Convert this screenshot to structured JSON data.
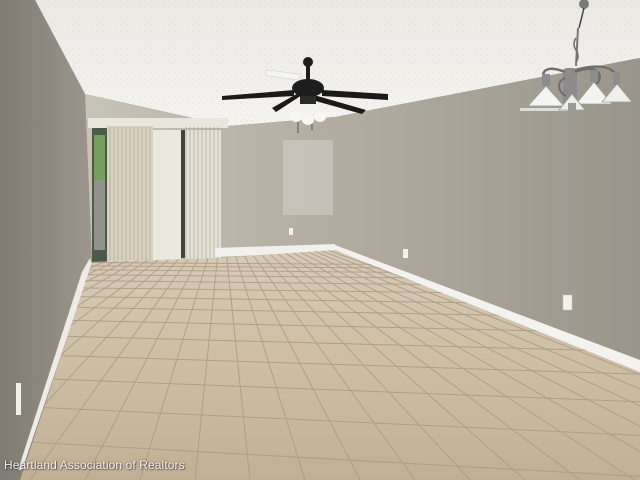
{
  "photo": {
    "subject": "empty living room with tile floor",
    "colors": {
      "ceiling": "#f0eee9",
      "wall_right": "#a7a295",
      "wall_back": "#bdb8ad",
      "wall_left": "#8e8a81",
      "floor_tile": "#cbbba3",
      "grout": "#a99a84",
      "baseboard": "#f4f2ee",
      "vertical_blinds": "#d6d0c2",
      "fan_body": "#1d1d1d",
      "chandelier_metal": "#8a8a8a"
    },
    "icons": [
      "ceiling-fan-icon",
      "chandelier-icon",
      "vertical-blinds-icon",
      "outlet-icon"
    ]
  },
  "watermark": {
    "text": "Heartland Association of Realtors"
  }
}
